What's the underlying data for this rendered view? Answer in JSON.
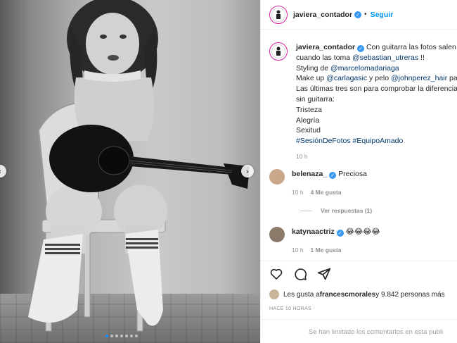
{
  "post": {
    "author": "javiera_contador",
    "follow_label": "Seguir",
    "caption_lines": [
      "Con guitarra las fotos salen m",
      "cuando las toma ",
      "@sebastian_utreras",
      " !!",
      "Styling de ",
      "@marcelomadariaga",
      "Make up ",
      "@carlagasic",
      " y pelo ",
      "@johnperez_hair",
      " pa",
      "Las últimas tres son para comprobar la diferencia",
      "sin guitarra:",
      "Tristeza",
      "Alegría",
      "Sexitud",
      "#SesiónDeFotos #EquipoAmado"
    ],
    "caption_time": "10 h"
  },
  "comments": [
    {
      "user": "belenaza_",
      "text": "Preciosa",
      "time": "10 h",
      "likes": "4 Me gusta",
      "view_replies": "Ver respuestas (1)"
    },
    {
      "user": "katynaactriz",
      "text": "😂😂😂😂",
      "time": "10 h",
      "likes": "1 Me gusta"
    }
  ],
  "likes_summary": {
    "prefix": "Les gusta a ",
    "user": "francescmorales",
    "suffix": " y 9.842 personas más"
  },
  "timestamp": "HACE 10 HORAS",
  "comments_limited": "Se han limitado los comentarios en esta publi",
  "carousel": {
    "count": 7,
    "active_index": 0
  },
  "icons": {
    "like": "heart-icon",
    "comment": "comment-icon",
    "share": "share-icon",
    "verified": "verified-badge-icon"
  },
  "colors": {
    "follow": "#0095f6",
    "link": "#00376b",
    "verified": "#3897f0",
    "meta": "#8e8e8e"
  }
}
